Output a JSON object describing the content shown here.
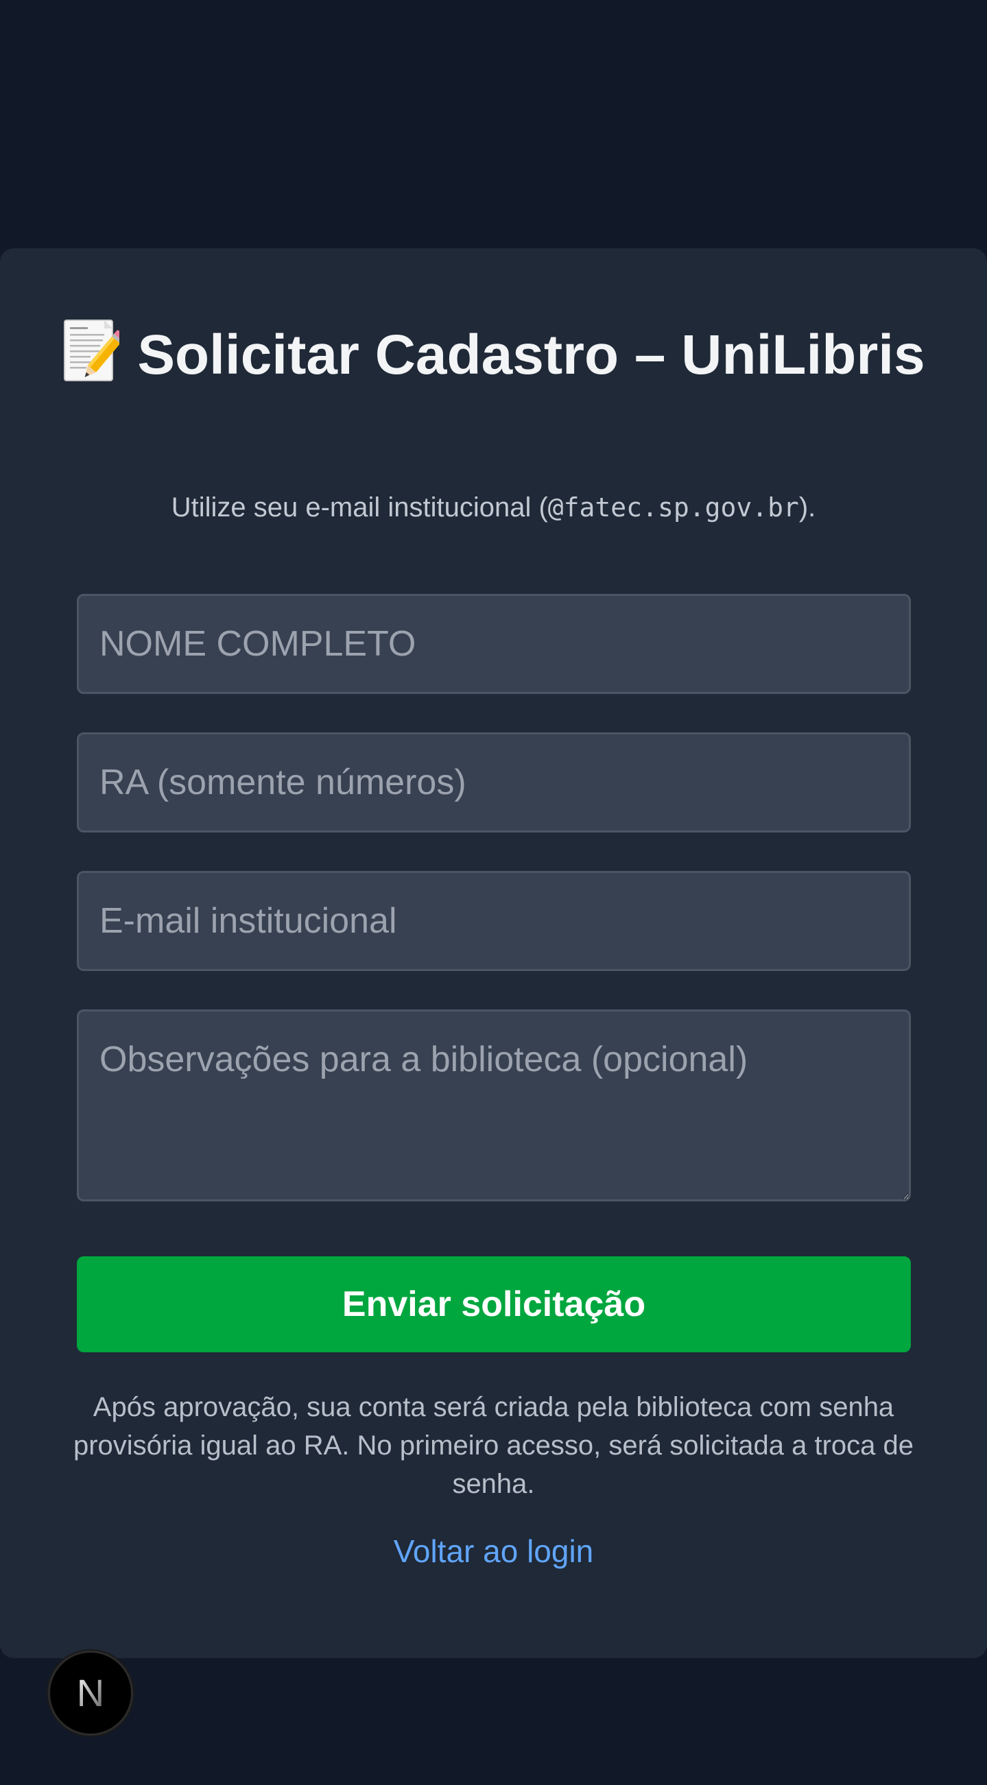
{
  "header": {
    "title": "Solicitar Cadastro – UniLibris",
    "title_icon": "memo-pencil-icon",
    "subtitle_prefix": "Utilize seu e-mail institucional (",
    "subtitle_domain": "@fatec.sp.gov.br",
    "subtitle_suffix": ")."
  },
  "form": {
    "name_placeholder": "NOME COMPLETO",
    "ra_placeholder": "RA (somente números)",
    "email_placeholder": "E-mail institucional",
    "notes_placeholder": "Observações para a biblioteca (opcional)",
    "submit_label": "Enviar solicitação"
  },
  "footer": {
    "note": "Após aprovação, sua conta será criada pela biblioteca com senha provisória igual ao RA. No primeiro acesso, será solicitada a troca de senha.",
    "back_link": "Voltar ao login"
  },
  "dev_badge": {
    "icon": "nextjs-logo-icon",
    "letter": "N"
  },
  "colors": {
    "background": "#111827",
    "card": "#1f2937",
    "input": "#374151",
    "primary_button": "#00a63e",
    "link": "#60a5fa"
  }
}
